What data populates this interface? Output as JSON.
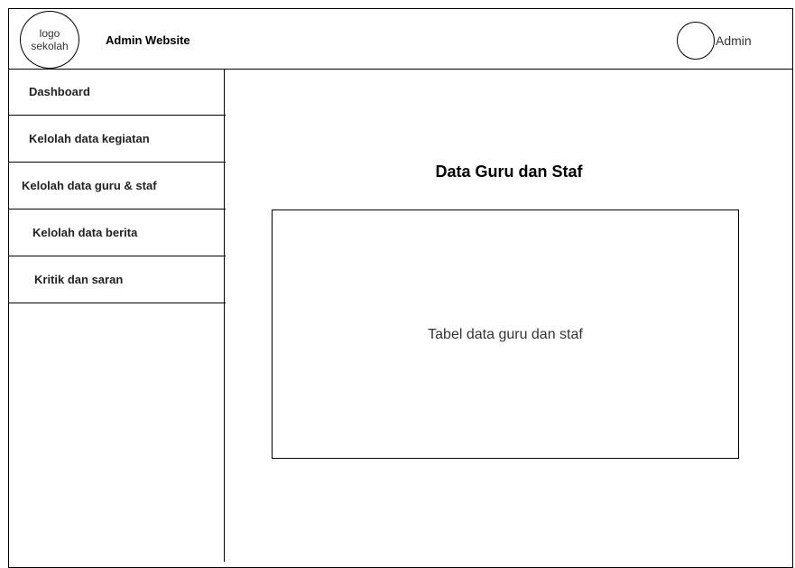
{
  "header": {
    "logo_line1": "logo",
    "logo_line2": "sekolah",
    "site_title": "Admin Website",
    "user_label": "Admin"
  },
  "sidebar": {
    "items": [
      {
        "label": "Dashboard"
      },
      {
        "label": "Kelolah data kegiatan"
      },
      {
        "label": "Kelolah data guru & staf"
      },
      {
        "label": "Kelolah data berita"
      },
      {
        "label": "Kritik dan saran"
      }
    ]
  },
  "main": {
    "title": "Data Guru dan Staf",
    "table_placeholder": "Tabel data guru dan staf"
  }
}
